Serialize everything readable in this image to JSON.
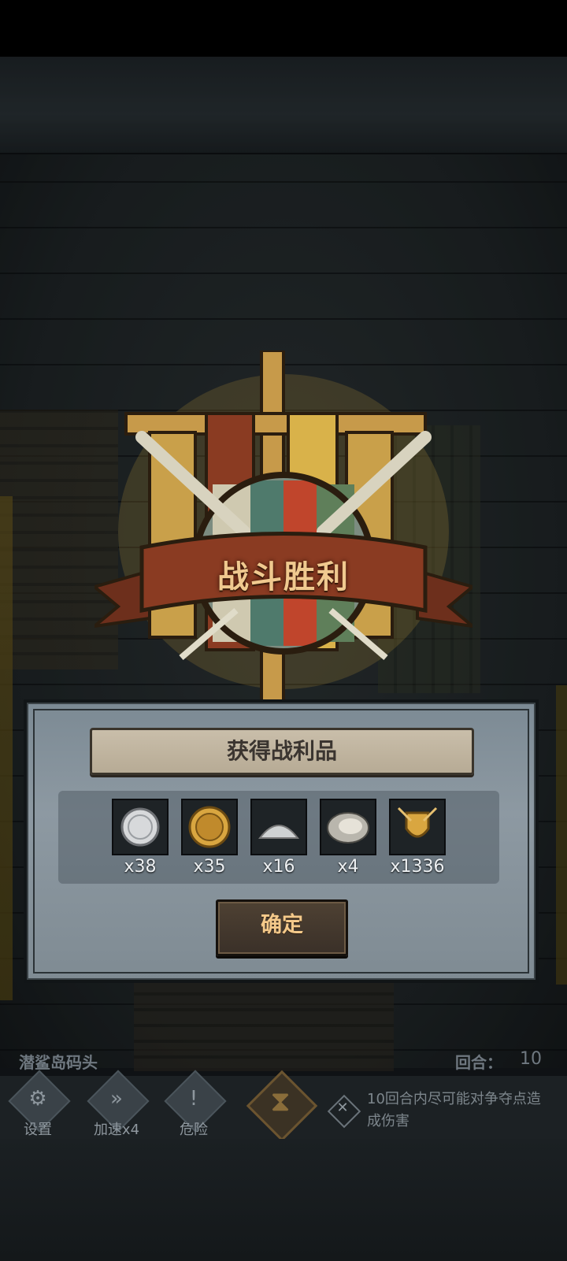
{
  "victory": {
    "title": "战斗胜利"
  },
  "reward_panel": {
    "title": "获得战利品",
    "items": [
      {
        "icon": "silver-coin-icon",
        "count": "x38"
      },
      {
        "icon": "gold-coin-icon",
        "count": "x35"
      },
      {
        "icon": "salt-pile-icon",
        "count": "x16"
      },
      {
        "icon": "oyster-icon",
        "count": "x4"
      },
      {
        "icon": "shield-crest-icon",
        "count": "x1336"
      }
    ],
    "confirm_label": "确定"
  },
  "hud": {
    "location": "潜鲨岛码头",
    "round_label": "回合：",
    "round_value": "10",
    "buttons": [
      {
        "icon": "gear-icon",
        "label": "设置"
      },
      {
        "icon": "fast-forward-icon",
        "label": "加速x4"
      },
      {
        "icon": "danger-icon",
        "label": "危险"
      }
    ],
    "hint": "10回合内尽可能对争夺点造成伤害"
  },
  "colors": {
    "accent_gold": "#f4c98a",
    "panel_gray": "#8d99a2",
    "banner_red": "#8a3b22"
  }
}
